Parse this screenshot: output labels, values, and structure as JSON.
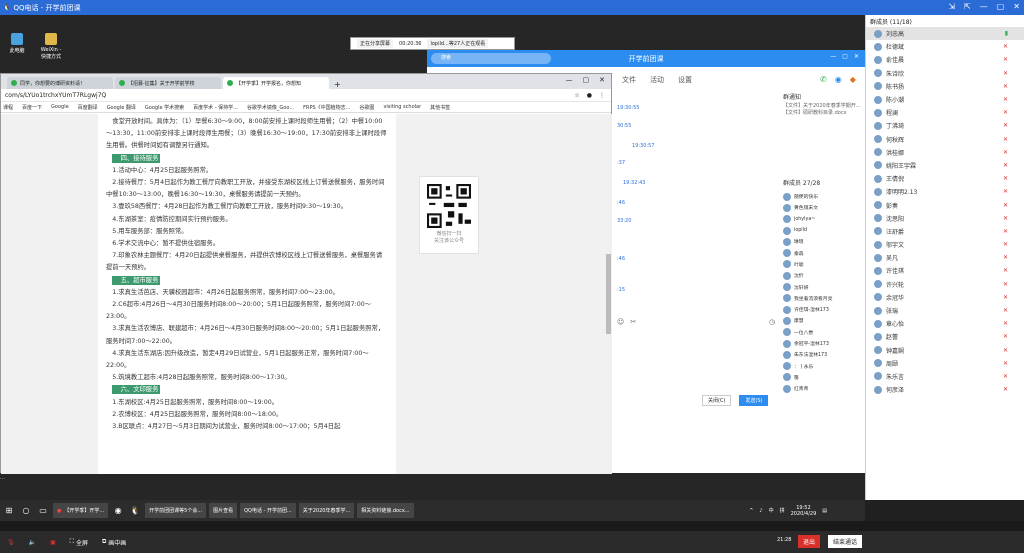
{
  "window": {
    "title": "QQ电话 - 开学前团课",
    "controls": [
      "⇲",
      "⇱",
      "—",
      "▢",
      "✕"
    ]
  },
  "desktop": {
    "icons": [
      {
        "label": "此电脑"
      },
      {
        "label": "WeiXin - 快捷方式"
      }
    ]
  },
  "share_bar": {
    "label": "正在分享屏幕",
    "time": "00:20:36",
    "note": "lopild...等27人正在观看"
  },
  "browser": {
    "tabs": [
      {
        "label": "同学，你想要的博研资料请！"
      },
      {
        "label": "【招募·征集】关于开学前学校"
      },
      {
        "label": "【开学季】开学报名，你想知"
      }
    ],
    "new_tab": "+",
    "url": "com/s/LYUo1trchxYUmT7RLgwj7Q",
    "bookmarks": [
      "课程",
      "百度一下",
      "Google",
      "百度翻译",
      "Google 翻译",
      "Google 学术搜索",
      "百度学术 - 保持学...",
      "谷歌学术镜像_Goo...",
      "FRPS《中国植物志...",
      "谷歌图",
      "visiting scholar",
      "其他书签"
    ],
    "article": [
      {
        "text": "食堂开放时间。具体为：（1）早餐6:30～9:00，8:00前安排上课时段师生用餐；（2）中餐10:00～13:30，11:00前安排非上课时段师生用餐；（3）晚餐16:30～19:00，17:30前安排非上课时段师生用餐。供餐时间如有调整另行通知。"
      },
      {
        "heading": "四、接待服务"
      },
      {
        "text": "1.活动中心：4月25日起服务照常。"
      },
      {
        "text": "2.接待餐厅：5月4日起作为教工餐厅向教职工开放，并接受东湖校区线上订餐送餐服务，服务时间中餐10:30～13:00，晚餐16:30～19:30，桌餐服务请提前一天预约。"
      },
      {
        "text": "3.壹玖58西餐厅：4月28日起作为教工餐厅向教职工开放，服务时间9:30～19:30。"
      },
      {
        "text": "4.东湖茶室：疫情防控期间实行预约服务。"
      },
      {
        "text": "5.用车服务部：服务照常。"
      },
      {
        "text": "6.学术交流中心：暂不提供住宿服务。"
      },
      {
        "text": "7.印象农林主题餐厅：4月20日起提供桌餐服务，并提供农博校区线上订餐送餐服务，桌餐服务请提前一天预约。"
      },
      {
        "heading": "五、超市服务"
      },
      {
        "text": "1.求真生活芭店、天骥校园超市：4月26日起服务照常，服务时间7:00～23:00。"
      },
      {
        "text": "2.C6超市:4月26日～4月30日服务时间8:00～20:00；5月1日起服务照常，服务时间7:00～23:00。"
      },
      {
        "text": "3.求真生活农博店、联建超市：4月26日～4月30日服务时间8:00～20:00；5月1日起服务照常，服务时间7:00～22:00。"
      },
      {
        "text": "4.求真生活东湖店:因升级改造，暂定4月29日试营业，5月1日起服务正常，服务时间7:00～22:00。"
      },
      {
        "text": "5.筑境教工超市:4月28日起服务照常，服务时间8:00～17:30。"
      },
      {
        "heading": "六、文印服务"
      },
      {
        "text": "1.东湖校区:4月25日起服务照常，服务时间8:00～19:00。"
      },
      {
        "text": "2.农博校区：4月25日起服务照常，服务时间8:00～18:00。"
      },
      {
        "text": "3.B区联点：4月27日～5月3日期间为试营业，服务时间8:00～17:00；5月4日起"
      }
    ],
    "qr_caption": [
      "微信扫一扫",
      "关注该公众号"
    ]
  },
  "chat": {
    "title": "开学前团课",
    "search_placeholder": "搜索",
    "menu": [
      "文件",
      "活动",
      "设置"
    ],
    "timestamps": [
      "19:30:55",
      "30:55",
      "19:30:57",
      ":37",
      "19:32:43",
      ":46",
      "33:20",
      ":46",
      ":15"
    ],
    "notice_title": "群通知",
    "notice_lines": [
      "【文件】关于2020年春季学期开...",
      "【文件】硕研教科目录.docx"
    ],
    "members_title": "群成员 27/28",
    "members": [
      "随便的快乐",
      "黄色镜末文",
      "johylya~",
      "lopild",
      "琳琅",
      "秦森",
      "叶聪",
      "沈忻",
      "沈轩妍",
      "我坐着流浪看月亮",
      "许佳琪-湿林173",
      "康慧",
      "一位八尝",
      "余冠平-湿林173",
      "朱东法湿林173",
      "： ) 永乐",
      "罄",
      "红青青"
    ],
    "buttons": {
      "close": "关闭(C)",
      "send": "发送(S)"
    }
  },
  "side": {
    "header": "群成员 (11/18)",
    "members": [
      "刘忠高",
      "杜德斌",
      "俞佳晨",
      "朱诗欣",
      "陈书扬",
      "陈小潮",
      "程澜",
      "丁沸琦",
      "何秋辉",
      "洪桂娜",
      "姚阳王宇霖",
      "王倩倪",
      "漆明明2.13",
      "彭奏",
      "沈思阳",
      "汪舒爵",
      "邬宇文",
      "吴凡",
      "许佳琪",
      "许兴轮",
      "余冠华",
      "张瑞",
      "章心怡",
      "赵蕾",
      "钟嘉娴",
      "周颐",
      "朱乐言",
      "何彦泽"
    ]
  },
  "taskbar": {
    "items": [
      "【开学季】开学...",
      "开学前团团课等5个会...",
      "图片查看",
      "QQ电话 - 开学前团...",
      "关于2020年春季学...",
      "相关资料链接.docx..."
    ],
    "tray": [
      "^",
      "中",
      "拼"
    ],
    "time": "19:52",
    "date": "2020/4/29"
  },
  "call_bar": {
    "items": [
      "",
      "",
      "",
      "全屏",
      "画中画"
    ],
    "duration": "21:28",
    "leave": "退出",
    "end": "结束通话"
  }
}
